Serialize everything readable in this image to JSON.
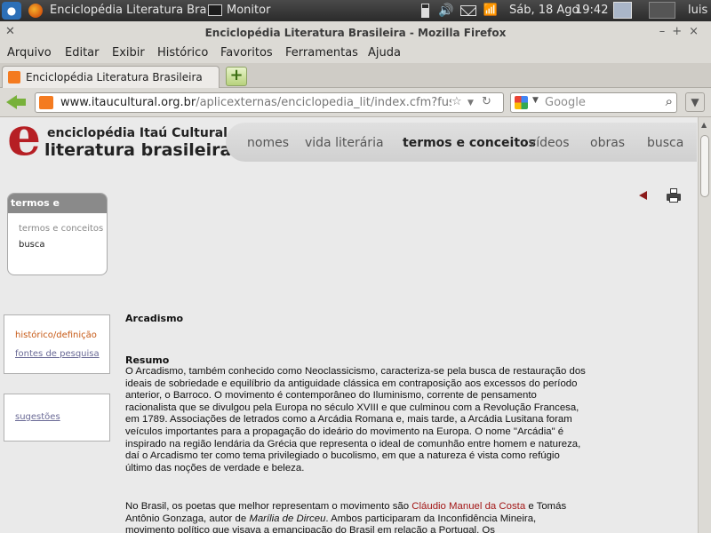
{
  "system_panel": {
    "app_title": "Enciclopédia Literatura Bras...",
    "monitor_label": "Monitor",
    "date": "Sáb, 18 Ago",
    "time": "19:42",
    "user": "luis"
  },
  "window": {
    "title": "Enciclopédia Literatura Brasileira - Mozilla Firefox",
    "close_glyph": "✕",
    "controls": "–+×"
  },
  "menu": {
    "items": [
      "Arquivo",
      "Editar",
      "Exibir",
      "Histórico",
      "Favoritos",
      "Ferramentas",
      "Ajuda"
    ]
  },
  "tabs": [
    {
      "label": "Enciclopédia Literatura Brasileira"
    }
  ],
  "newtab_label": "+",
  "nav": {
    "url_domain": "www.itaucultural.org.br",
    "url_path": "/aplicexternas/enciclopedia_lit/index.cfm?fuseact",
    "search_placeholder": "Google",
    "menu_glyph": "▼"
  },
  "site": {
    "logo_letter": "e",
    "logo_line1": "enciclopédia Itaú Cultural",
    "logo_line2": "literatura brasileira",
    "nav_items": [
      "nomes",
      "vida literária",
      "termos e conceitos",
      "vídeos",
      "obras",
      "busca"
    ],
    "active_nav": "termos e conceitos"
  },
  "sidebar": {
    "termos_box": {
      "header": "termos e conceitos",
      "links": [
        "termos e conceitos",
        "busca"
      ]
    },
    "hist_box": {
      "links": [
        "histórico/definição",
        "fontes de pesquisa"
      ]
    },
    "sugestoes": "sugestões"
  },
  "article": {
    "title": "Arcadismo",
    "resumo_label": "Resumo",
    "paragraph1": "O Arcadismo, também conhecido como Neoclassicismo, caracteriza-se pela busca de restauração dos ideais de sobriedade e equilíbrio da antiguidade clássica em contraposição aos excessos do período anterior, o Barroco. O movimento é contemporâneo do Iluminismo, corrente de pensamento racionalista que se divulgou pela Europa no século XVIII e que culminou com a Revolução Francesa, em 1789. Associações de letrados como a Arcádia Romana e, mais tarde, a Arcádia Lusitana foram veículos importantes para a propagação do ideário do movimento na Europa. O nome \"Arcádia\" é inspirado na região lendária da Grécia que representa o ideal de comunhão entre homem e natureza, daí o Arcadismo ter como tema privilegiado o bucolismo, em que a natureza é vista como refúgio último das noções de verdade e beleza.",
    "p2_before": "No Brasil, os poetas que melhor representam o movimento são ",
    "p2_person1": "Cláudio Manuel da Costa",
    "p2_mid": " e Tomás Antônio Gonzaga, autor de ",
    "p2_work": "Marília de Dirceu",
    "p2_after": ". Ambos participaram da Inconfidência Mineira, movimento político que visava a emancipação do Brasil em relação a Portugal. Os"
  },
  "colors": {
    "brand_red": "#b61f24",
    "link_orange": "#c75a16",
    "link_person": "#a31818"
  }
}
